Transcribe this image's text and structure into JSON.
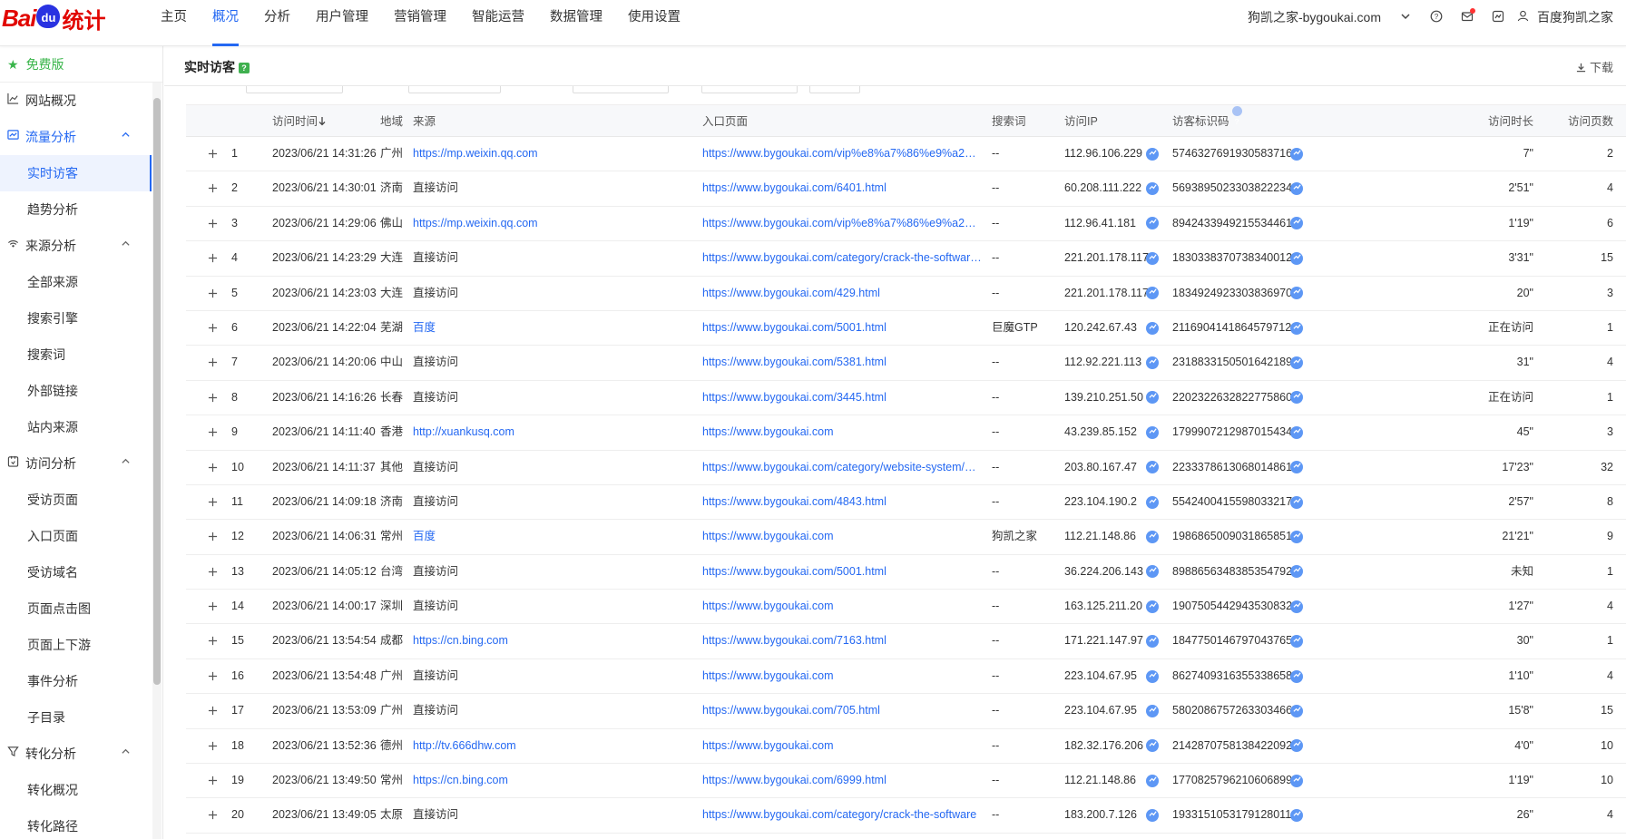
{
  "logo": {
    "bai": "Bai",
    "du": "du",
    "tongji": "统计"
  },
  "nav": [
    "主页",
    "概况",
    "分析",
    "用户管理",
    "营销管理",
    "智能运营",
    "数据管理",
    "使用设置"
  ],
  "nav_active": 1,
  "topright": {
    "site": "狗凯之家-bygoukai.com",
    "user": "百度狗凯之家"
  },
  "sidebar": {
    "free": "免费版",
    "items": [
      {
        "type": "group",
        "label": "网站概况",
        "icon": "line-chart-icon"
      },
      {
        "type": "group",
        "label": "流量分析",
        "icon": "traffic-icon",
        "active": true
      },
      {
        "type": "item",
        "label": "实时访客",
        "active": true
      },
      {
        "type": "item",
        "label": "趋势分析"
      },
      {
        "type": "group",
        "label": "来源分析",
        "icon": "signal-icon"
      },
      {
        "type": "item",
        "label": "全部来源"
      },
      {
        "type": "item",
        "label": "搜索引擎"
      },
      {
        "type": "item",
        "label": "搜索词"
      },
      {
        "type": "item",
        "label": "外部链接"
      },
      {
        "type": "item",
        "label": "站内来源"
      },
      {
        "type": "group",
        "label": "访问分析",
        "icon": "visit-icon"
      },
      {
        "type": "item",
        "label": "受访页面"
      },
      {
        "type": "item",
        "label": "入口页面"
      },
      {
        "type": "item",
        "label": "受访域名"
      },
      {
        "type": "item",
        "label": "页面点击图"
      },
      {
        "type": "item",
        "label": "页面上下游"
      },
      {
        "type": "item",
        "label": "事件分析"
      },
      {
        "type": "item",
        "label": "子目录"
      },
      {
        "type": "group",
        "label": "转化分析",
        "icon": "funnel-icon"
      },
      {
        "type": "item",
        "label": "转化概况"
      },
      {
        "type": "item",
        "label": "转化路径"
      }
    ]
  },
  "content": {
    "title": "实时访客",
    "help": "?",
    "download": "下载"
  },
  "table": {
    "headers": {
      "time": "访问时间",
      "region": "地域",
      "source": "来源",
      "entry": "入口页面",
      "keyword": "搜索词",
      "ip": "访问IP",
      "visitor_id": "访客标识码",
      "duration": "访问时长",
      "pages": "访问页数"
    },
    "rows": [
      [
        "1",
        "2023/06/21 14:31:26",
        "广州",
        "https://mp.weixin.qq.com",
        "https://www.bygoukai.com/vip%e8%a7%86%e9%a2%91%e8%...",
        "--",
        "112.96.106.229",
        "5746327691930583716",
        "7\"",
        "2"
      ],
      [
        "2",
        "2023/06/21 14:30:01",
        "济南",
        "直接访问",
        "https://www.bygoukai.com/6401.html",
        "--",
        "60.208.111.222",
        "5693895023303822234",
        "2'51\"",
        "4"
      ],
      [
        "3",
        "2023/06/21 14:29:06",
        "佛山",
        "https://mp.weixin.qq.com",
        "https://www.bygoukai.com/vip%e8%a7%86%e9%a2%91%e8%...",
        "--",
        "112.96.41.181",
        "8942433949215534461",
        "1'19\"",
        "6"
      ],
      [
        "4",
        "2023/06/21 14:23:29",
        "大连",
        "直接访问",
        "https://www.bygoukai.com/category/crack-the-software/%e6%8...",
        "--",
        "221.201.178.117",
        "1830338370738340012",
        "3'31\"",
        "15"
      ],
      [
        "5",
        "2023/06/21 14:23:03",
        "大连",
        "直接访问",
        "https://www.bygoukai.com/429.html",
        "--",
        "221.201.178.117",
        "1834924923303836970",
        "20\"",
        "3"
      ],
      [
        "6",
        "2023/06/21 14:22:04",
        "芜湖",
        "百度",
        "https://www.bygoukai.com/5001.html",
        "巨魔GTP",
        "120.242.67.43",
        "2116904141864579712",
        "正在访问",
        "1"
      ],
      [
        "7",
        "2023/06/21 14:20:06",
        "中山",
        "直接访问",
        "https://www.bygoukai.com/5381.html",
        "--",
        "112.92.221.113",
        "2318833150501642189",
        "31\"",
        "4"
      ],
      [
        "8",
        "2023/06/21 14:16:26",
        "长春",
        "直接访问",
        "https://www.bygoukai.com/3445.html",
        "--",
        "139.210.251.50",
        "2202322632822775860",
        "正在访问",
        "1"
      ],
      [
        "9",
        "2023/06/21 14:11:40",
        "香港",
        "http://xuankusq.com",
        "https://www.bygoukai.com",
        "--",
        "43.239.85.152",
        "1799907212987015434",
        "45\"",
        "3"
      ],
      [
        "10",
        "2023/06/21 14:11:37",
        "其他",
        "直接访问",
        "https://www.bygoukai.com/category/website-system/%e7%bd%...",
        "--",
        "203.80.167.47",
        "2233378613068014861",
        "17'23\"",
        "32"
      ],
      [
        "11",
        "2023/06/21 14:09:18",
        "济南",
        "直接访问",
        "https://www.bygoukai.com/4843.html",
        "--",
        "223.104.190.2",
        "5542400415598033217",
        "2'57\"",
        "8"
      ],
      [
        "12",
        "2023/06/21 14:06:31",
        "常州",
        "百度",
        "https://www.bygoukai.com",
        "狗凯之家",
        "112.21.148.86",
        "1986865009031865851",
        "21'21\"",
        "9"
      ],
      [
        "13",
        "2023/06/21 14:05:12",
        "台湾",
        "直接访问",
        "https://www.bygoukai.com/5001.html",
        "--",
        "36.224.206.143",
        "8988656348385354792",
        "未知",
        "1"
      ],
      [
        "14",
        "2023/06/21 14:00:17",
        "深圳",
        "直接访问",
        "https://www.bygoukai.com",
        "--",
        "163.125.211.20",
        "1907505442943530832",
        "1'27\"",
        "4"
      ],
      [
        "15",
        "2023/06/21 13:54:54",
        "成都",
        "https://cn.bing.com",
        "https://www.bygoukai.com/7163.html",
        "--",
        "171.221.147.97",
        "1847750146797043765",
        "30\"",
        "1"
      ],
      [
        "16",
        "2023/06/21 13:54:48",
        "广州",
        "直接访问",
        "https://www.bygoukai.com",
        "--",
        "223.104.67.95",
        "8627409316355338658",
        "1'10\"",
        "4"
      ],
      [
        "17",
        "2023/06/21 13:53:09",
        "广州",
        "直接访问",
        "https://www.bygoukai.com/705.html",
        "--",
        "223.104.67.95",
        "5802086757263303466",
        "15'8\"",
        "15"
      ],
      [
        "18",
        "2023/06/21 13:52:36",
        "德州",
        "http://tv.666dhw.com",
        "https://www.bygoukai.com",
        "--",
        "182.32.176.206",
        "2142870758138422092",
        "4'0\"",
        "10"
      ],
      [
        "19",
        "2023/06/21 13:49:50",
        "常州",
        "https://cn.bing.com",
        "https://www.bygoukai.com/6999.html",
        "--",
        "112.21.148.86",
        "1770825796210606899",
        "1'19\"",
        "10"
      ],
      [
        "20",
        "2023/06/21 13:49:05",
        "太原",
        "直接访问",
        "https://www.bygoukai.com/category/crack-the-software",
        "--",
        "183.200.7.126",
        "1933151053179128011",
        "26\"",
        "4"
      ]
    ]
  }
}
